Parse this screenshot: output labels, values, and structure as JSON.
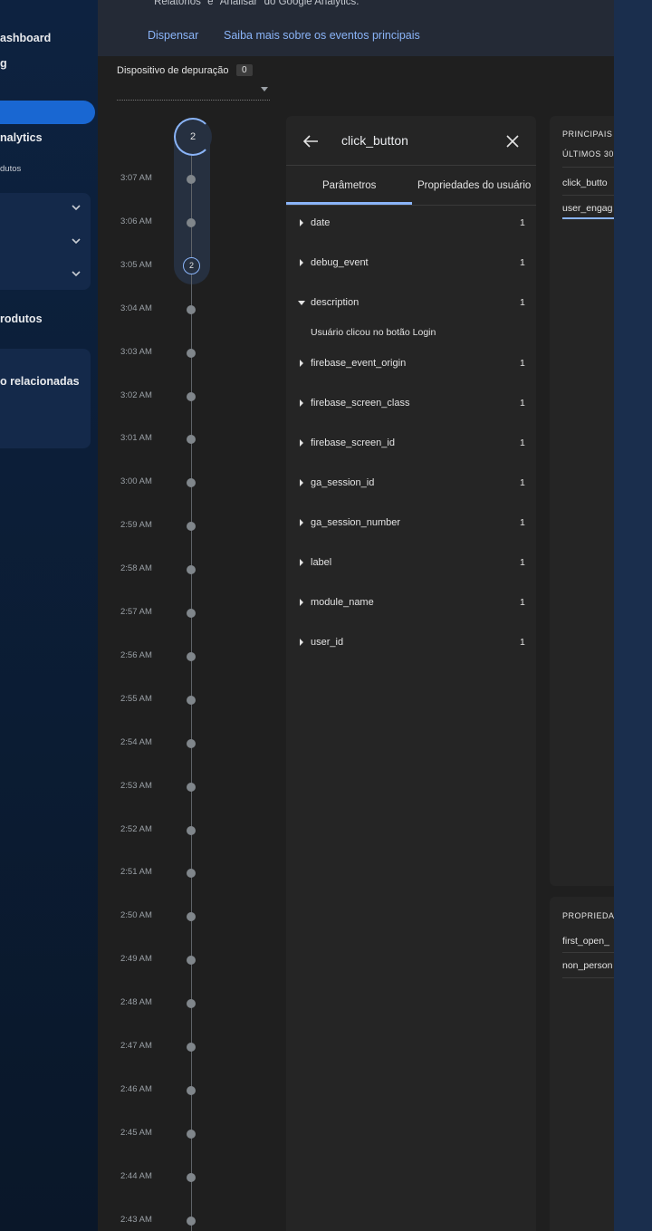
{
  "sidebar": {
    "dashboard_label": "ashboard",
    "second_label": "g",
    "active_label": "",
    "analytics_label": "nalytics",
    "products_small": "dutos",
    "products_label": "rodutos",
    "related_label": "o relacionadas"
  },
  "banner": {
    "text": "\"Relatórios\" e \"Analisar\" do Google Analytics.",
    "dismiss": "Dispensar",
    "learn_more": "Saiba mais sobre os eventos principais"
  },
  "debug": {
    "label": "Dispositivo de depuração",
    "count": "0"
  },
  "timeline": {
    "top_count": "2",
    "mid_count": "2",
    "times": [
      "3:07 AM",
      "3:06 AM",
      "3:05 AM",
      "3:04 AM",
      "3:03 AM",
      "3:02 AM",
      "3:01 AM",
      "3:00 AM",
      "2:59 AM",
      "2:58 AM",
      "2:57 AM",
      "2:56 AM",
      "2:55 AM",
      "2:54 AM",
      "2:53 AM",
      "2:52 AM",
      "2:51 AM",
      "2:50 AM",
      "2:49 AM",
      "2:48 AM",
      "2:47 AM",
      "2:46 AM",
      "2:45 AM",
      "2:44 AM",
      "2:43 AM"
    ]
  },
  "detail": {
    "title": "click_button",
    "tabs": [
      "Parâmetros",
      "Propriedades do usuário"
    ],
    "description_value": "Usuário clicou no botão Login",
    "params": [
      {
        "name": "date",
        "count": "1"
      },
      {
        "name": "debug_event",
        "count": "1"
      },
      {
        "name": "description",
        "count": "1"
      },
      {
        "name": "firebase_event_origin",
        "count": "1"
      },
      {
        "name": "firebase_screen_class",
        "count": "1"
      },
      {
        "name": "firebase_screen_id",
        "count": "1"
      },
      {
        "name": "ga_session_id",
        "count": "1"
      },
      {
        "name": "ga_session_number",
        "count": "1"
      },
      {
        "name": "label",
        "count": "1"
      },
      {
        "name": "module_name",
        "count": "1"
      },
      {
        "name": "user_id",
        "count": "1"
      }
    ]
  },
  "top_events": {
    "heading": "PRINCIPAIS",
    "subheading": "ÚLTIMOS 30",
    "items": [
      "click_butto",
      "user_engag"
    ]
  },
  "user_props": {
    "heading": "PROPRIEDA",
    "items": [
      "first_open_",
      "non_person"
    ]
  }
}
